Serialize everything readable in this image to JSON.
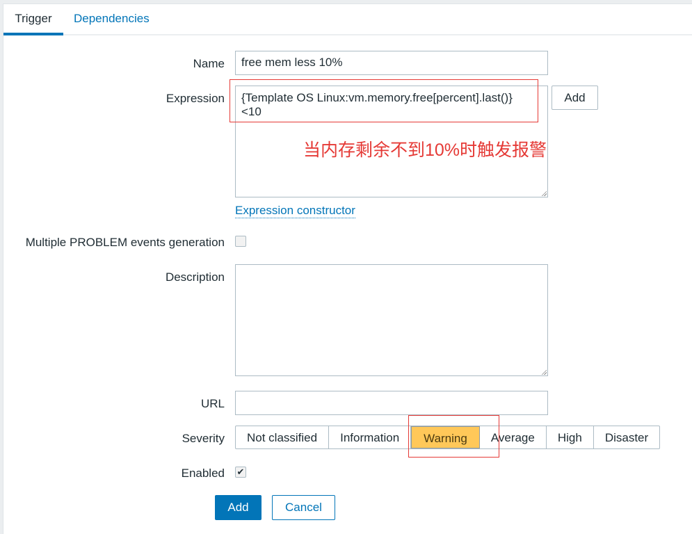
{
  "tabs": [
    {
      "label": "Trigger"
    },
    {
      "label": "Dependencies"
    }
  ],
  "form": {
    "name_label": "Name",
    "name_value": "free mem less 10%",
    "expression_label": "Expression",
    "expression_line1": "{Template OS Linux:vm.memory.free[percent].last()}",
    "expression_line2": "<10",
    "expression_add": "Add",
    "annotation": "当内存剩余不到10%时触发报警",
    "constructor_link": "Expression constructor",
    "multiple_label": "Multiple PROBLEM events generation",
    "description_label": "Description",
    "description_value": "",
    "url_label": "URL",
    "url_value": "",
    "severity_label": "Severity",
    "severity_options": [
      "Not classified",
      "Information",
      "Warning",
      "Average",
      "High",
      "Disaster"
    ],
    "severity_selected": "Warning",
    "enabled_label": "Enabled",
    "enabled_mark": "✔",
    "add_button": "Add",
    "cancel_button": "Cancel"
  },
  "colors": {
    "accent": "#0275b8",
    "warning": "#ffc859",
    "annotation": "#e53935"
  }
}
